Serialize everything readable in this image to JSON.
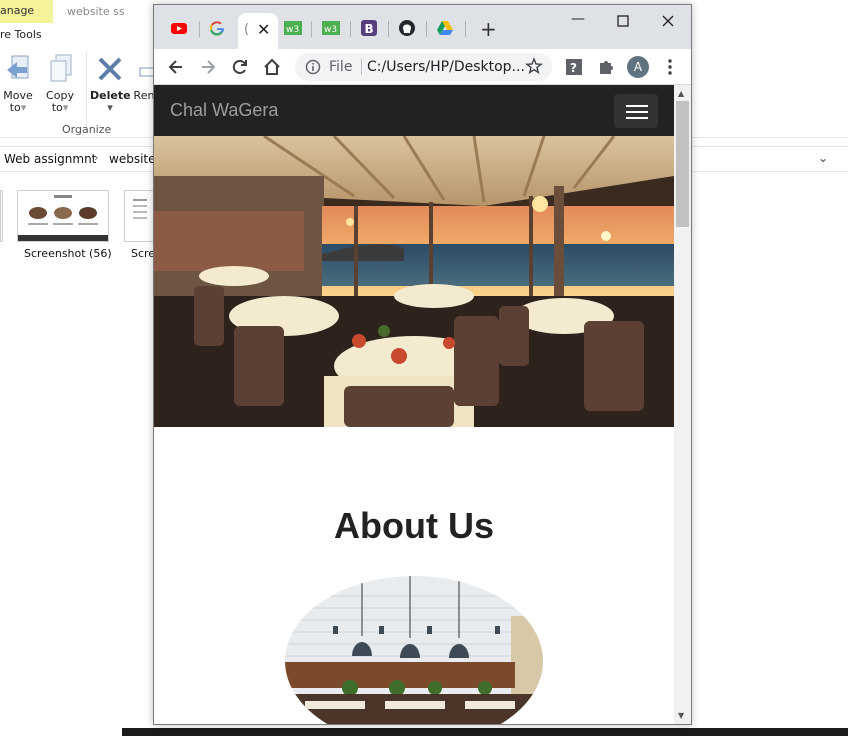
{
  "explorer": {
    "ribbon_tab_manage": "anage",
    "tab_title": "website ss",
    "tools_label": "re Tools",
    "ribbon_buttons": {
      "move_to": [
        "Move",
        "to"
      ],
      "copy_to": [
        "Copy",
        "to"
      ],
      "delete": "Delete",
      "rename": "Ren"
    },
    "group_label": "Organize",
    "breadcrumb": [
      "Web assignmnt",
      "website s"
    ],
    "files": [
      "Screenshot (56)",
      "Scre"
    ]
  },
  "browser": {
    "new_tab_glyph": "+",
    "omnibox": {
      "scheme_label": "File",
      "url": "C:/Users/HP/Desktop..."
    },
    "profile_initial": "A"
  },
  "page": {
    "brand": "Chal WaGera",
    "about_title": "About Us"
  },
  "colors": {
    "navbar_bg": "#222222",
    "brand_text": "#9d9d9d",
    "tabstrip_bg": "#dee1e6",
    "manage_tab_bg": "#f5f39a"
  },
  "icons": [
    "youtube-icon",
    "google-icon",
    "w3schools-icon",
    "bootstrap-icon",
    "github-icon",
    "google-drive-icon",
    "back-icon",
    "forward-icon",
    "reload-icon",
    "home-icon",
    "info-icon",
    "star-icon",
    "extension-help-icon",
    "puzzle-icon",
    "menu-dots-icon",
    "minimize-icon",
    "maximize-icon",
    "close-icon"
  ]
}
